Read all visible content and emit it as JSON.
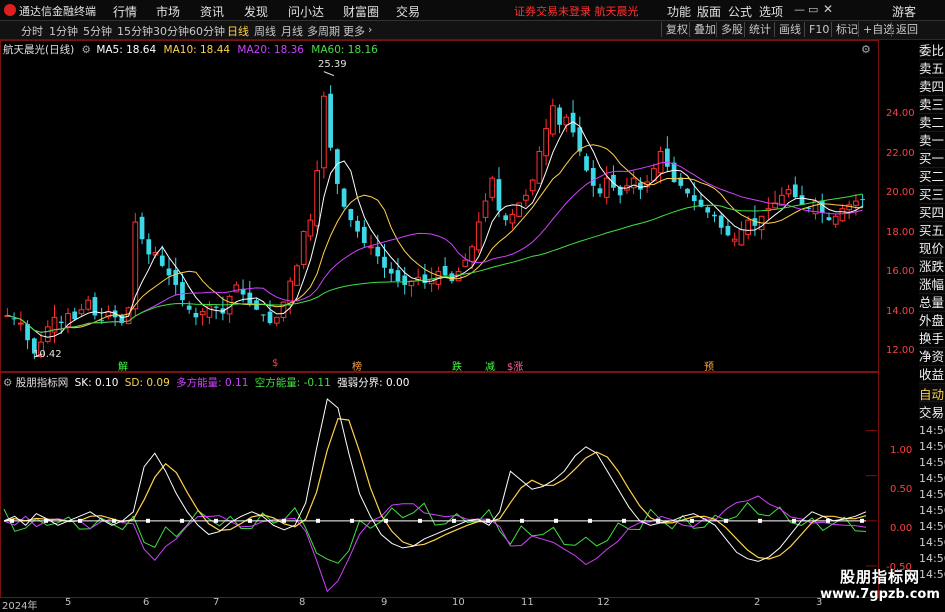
{
  "topbar": {
    "app_name": "通达信金融终端",
    "menu": [
      "行情",
      "市场",
      "资讯",
      "发现",
      "问小达",
      "财富圈",
      "交易"
    ],
    "notice": "证券交易未登录  航天晨光",
    "right_menu": [
      "功能",
      "版面",
      "公式",
      "选项"
    ],
    "user": "游客"
  },
  "toolbar": {
    "timeframes": [
      "分时",
      "1分钟",
      "5分钟",
      "15分钟",
      "30分钟",
      "60分钟",
      "日线",
      "周线",
      "月线",
      "多周期",
      "更多"
    ],
    "active_timeframe": "日线",
    "buttons": [
      "复权",
      "叠加",
      "多股",
      "统计",
      "画线",
      "F10",
      "标记",
      "+自选",
      "返回"
    ]
  },
  "main_chart": {
    "stock": "航天晨光(日线)",
    "ma": [
      {
        "label": "MA5: 18.64",
        "color": "#ffffff"
      },
      {
        "label": "MA10: 18.44",
        "color": "#ffd24a"
      },
      {
        "label": "MA20: 18.36",
        "color": "#d040ff"
      },
      {
        "label": "MA60: 18.16",
        "color": "#40e040"
      }
    ],
    "high_label": "25.39",
    "low_label": "10.42",
    "price_ticks": [
      "24.00",
      "22.00",
      "20.00",
      "18.00",
      "16.00",
      "14.00",
      "12.00"
    ],
    "markers": [
      {
        "text": "解",
        "color": "#40ff40"
      },
      {
        "text": "$",
        "color": "#ff4040"
      },
      {
        "text": "榜",
        "color": "#ffa040"
      },
      {
        "text": "跌",
        "color": "#40ff40"
      },
      {
        "text": "减",
        "color": "#40ff40"
      },
      {
        "text": "$涨",
        "color": "#ff60a0"
      },
      {
        "text": "预",
        "color": "#ffa040"
      }
    ]
  },
  "oscillator": {
    "name": "股朋指标网",
    "items": [
      {
        "label": "SK: 0.10",
        "color": "#ffffff"
      },
      {
        "label": "SD: 0.09",
        "color": "#ffd24a"
      },
      {
        "label": "多方能量: 0.11",
        "color": "#d040ff"
      },
      {
        "label": "空方能量: -0.11",
        "color": "#40e040"
      },
      {
        "label": "强弱分界: 0.00",
        "color": "#ffffff"
      }
    ],
    "ticks": [
      "1.00",
      "0.50",
      "0.00",
      "-0.50"
    ]
  },
  "date_axis": [
    "2024年",
    "5",
    "6",
    "7",
    "8",
    "9",
    "10",
    "11",
    "12",
    "2",
    "3"
  ],
  "side_panel": {
    "items": [
      "委比",
      "卖五",
      "卖四",
      "卖三",
      "卖二",
      "卖一",
      "买一",
      "买二",
      "买三",
      "买四",
      "买五",
      "现价",
      "涨跌",
      "涨幅",
      "总量",
      "外盘",
      "换手",
      "净资",
      "收益"
    ],
    "auto_label": "自动",
    "trade_label": "交易",
    "times": [
      "14:56",
      "14:56",
      "14:56",
      "14:56",
      "14:56",
      "14:56",
      "14:56",
      "14:56",
      "14:56",
      "14:56"
    ]
  },
  "watermark": {
    "title": "股朋指标网",
    "url": "www.7gpzb.com"
  },
  "chart_data": {
    "type": "candlestick",
    "symbol": "航天晨光",
    "period": "日线",
    "ylim": [
      10,
      26
    ],
    "series": [
      {
        "name": "MA5",
        "color": "#ffffff"
      },
      {
        "name": "MA10",
        "color": "#ffd24a"
      },
      {
        "name": "MA20",
        "color": "#d040ff"
      },
      {
        "name": "MA60",
        "color": "#40e040"
      }
    ],
    "close_path": [
      12.6,
      12.4,
      12.2,
      11.3,
      10.6,
      11.2,
      12.0,
      12.5,
      12.2,
      12.7,
      12.4,
      12.9,
      13.4,
      12.6,
      12.3,
      12.8,
      12.5,
      12.2,
      13.0,
      17.5,
      16.6,
      15.8,
      15.9,
      15.2,
      14.7,
      14.2,
      13.4,
      12.9,
      12.5,
      12.8,
      13.1,
      13.0,
      12.7,
      13.6,
      14.2,
      13.7,
      13.2,
      12.9,
      12.6,
      12.2,
      12.5,
      13.3,
      14.4,
      15.2,
      17.0,
      17.6,
      20.2,
      24.1,
      21.4,
      19.5,
      18.3,
      17.6,
      17.0,
      16.4,
      16.2,
      15.7,
      15.1,
      14.8,
      14.4,
      14.2,
      14.4,
      14.6,
      14.3,
      14.5,
      14.9,
      14.7,
      14.4,
      14.9,
      15.5,
      16.2,
      17.5,
      18.6,
      19.8,
      18.1,
      17.6,
      17.9,
      18.5,
      18.9,
      19.7,
      21.2,
      22.4,
      23.6,
      22.6,
      23.0,
      22.2,
      21.2,
      20.2,
      19.4,
      19.0,
      19.8,
      19.3,
      18.9,
      19.4,
      19.8,
      19.2,
      19.6,
      20.3,
      21.2,
      20.4,
      19.6,
      19.4,
      19.0,
      18.6,
      18.3,
      18.0,
      17.8,
      17.2,
      16.8,
      16.6,
      17.1,
      17.6,
      17.3,
      17.8,
      18.2,
      18.5,
      18.9,
      19.2,
      18.8,
      18.4,
      18.2,
      18.6,
      18.0,
      17.6,
      17.8,
      18.2,
      18.4,
      18.6,
      18.7
    ],
    "low_mark": 10.42,
    "high_mark": 25.39,
    "oscillator": {
      "name": "股朋指标网",
      "ylim": [
        -0.8,
        1.45
      ],
      "SK": 0.1,
      "SD": 0.09,
      "long_energy": 0.11,
      "short_energy": -0.11,
      "divider": 0.0,
      "sk_path": [
        0.0,
        0.05,
        -0.05,
        0.08,
        0.02,
        -0.05,
        0.0,
        0.05,
        0.1,
        0.02,
        -0.05,
        0.0,
        0.1,
        0.6,
        0.75,
        0.55,
        0.3,
        0.1,
        -0.05,
        -0.15,
        -0.12,
        -0.02,
        0.05,
        0.1,
        0.05,
        -0.05,
        -0.1,
        -0.05,
        0.2,
        0.8,
        1.35,
        1.25,
        0.75,
        0.3,
        0.05,
        -0.15,
        -0.25,
        -0.3,
        -0.28,
        -0.2,
        -0.15,
        -0.1,
        -0.05,
        0.0,
        0.02,
        -0.05,
        0.1,
        0.55,
        0.45,
        0.35,
        0.38,
        0.45,
        0.55,
        0.72,
        0.82,
        0.75,
        0.55,
        0.35,
        0.15,
        0.0,
        -0.05,
        -0.02,
        0.0,
        0.05,
        0.08,
        0.02,
        -0.05,
        -0.2,
        -0.35,
        -0.42,
        -0.45,
        -0.4,
        -0.3,
        -0.15,
        0.0,
        0.1,
        0.05,
        0.0,
        0.02,
        0.05,
        0.1
      ]
    }
  }
}
